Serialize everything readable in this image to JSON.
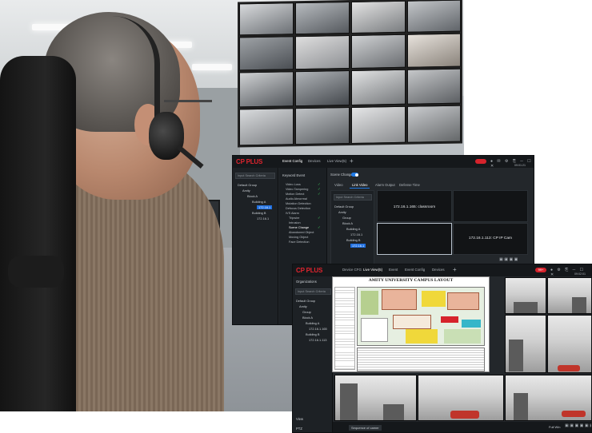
{
  "back_window": {
    "logo": "CP PLUS",
    "tabs": [
      "Event Config",
      "Devices",
      "Live View(5)"
    ],
    "plus": "+",
    "clock": "09:01:21",
    "search_placeholder": "Input Search Criteria",
    "tree": [
      "Default Group",
      "Amity",
      "Block A",
      "Building A",
      "172.16.1",
      "Building B",
      "172.16.1"
    ],
    "keyword_panel_title": "Keyword Event",
    "scene_change_label": "Scene Change",
    "subtabs": [
      "Video",
      "Link Video",
      "Alarm Output",
      "Defense Time"
    ],
    "events": [
      "Video Loss",
      "Video Tampering",
      "Motion Detect",
      "Audio Abnormal",
      "Mutation Detection",
      "Defocus Detection",
      "IVS Alarm",
      "Tripwire",
      "Intrusion",
      "Scene Change",
      "Abandoned Object",
      "Moving Object",
      "Face Detection"
    ],
    "link_search_placeholder": "Input Search Criteria",
    "link_tree": [
      "Default Group",
      "Amity",
      "Group",
      "Block A",
      "Building A",
      "172.16.1",
      "Building B",
      "172.16.1"
    ],
    "cell_labels": [
      "172.16.1.165: classroom",
      "172.16.1.113: CP IP Cam"
    ]
  },
  "front_window": {
    "logo": "CP PLUS",
    "tabs": [
      "Device CFG",
      "Live View(5)",
      "Event",
      "Event Config",
      "Devices"
    ],
    "plus": "+",
    "alarm_count": "99+",
    "clock": "09:02:01",
    "panel_title": "Organizations",
    "search_placeholder": "Input Search Criteria",
    "tree": [
      "Default Group",
      "Amity",
      "Group",
      "Block A",
      "Building A",
      "172.16.1.165",
      "Building B",
      "172.16.1.113"
    ],
    "bottom_items": [
      "View",
      "PTZ"
    ],
    "sequence_label": "Sequence of camer",
    "fullwin_label": "Full Win",
    "map_title": "AMITY UNIVERSITY CAMPUS LAYOUT"
  }
}
